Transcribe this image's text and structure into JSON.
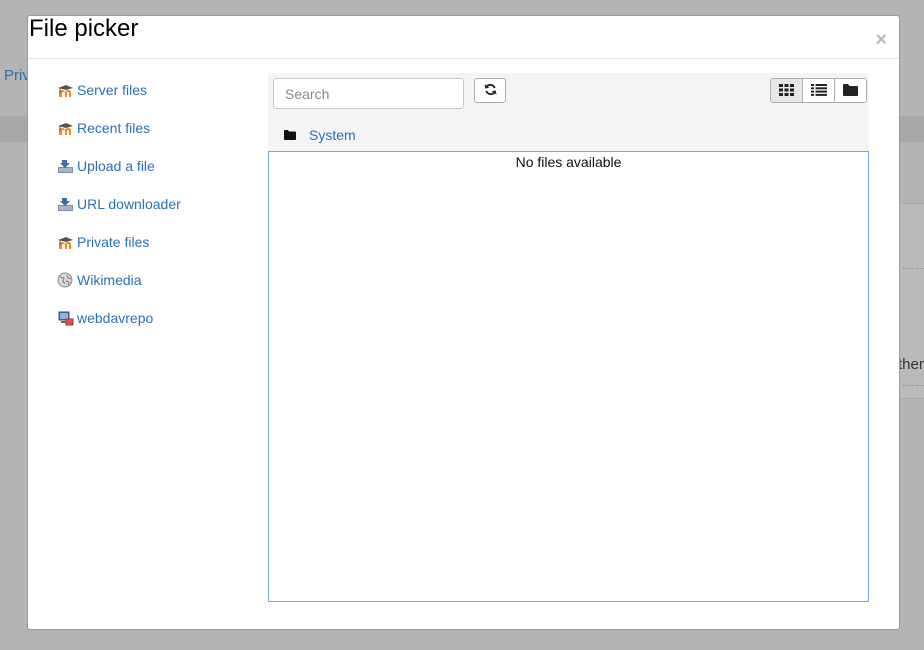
{
  "background": {
    "truncated_link": "Priv",
    "truncated_text": "them"
  },
  "modal": {
    "title": "File picker",
    "close_glyph": "×"
  },
  "repositories": [
    {
      "label": "Server files",
      "icon": "moodle-icon"
    },
    {
      "label": "Recent files",
      "icon": "moodle-icon"
    },
    {
      "label": "Upload a file",
      "icon": "upload-icon"
    },
    {
      "label": "URL downloader",
      "icon": "url-download-icon"
    },
    {
      "label": "Private files",
      "icon": "moodle-icon"
    },
    {
      "label": "Wikimedia",
      "icon": "wikimedia-globe-icon"
    },
    {
      "label": "webdavrepo",
      "icon": "webdav-computer-icon"
    }
  ],
  "toolbar": {
    "search_placeholder": "Search",
    "refresh_icon": "refresh-icon",
    "views": [
      {
        "name": "icons",
        "icon": "grid-view-icon",
        "active": true
      },
      {
        "name": "list",
        "icon": "list-view-icon",
        "active": false
      },
      {
        "name": "tree",
        "icon": "folder-view-icon",
        "active": false
      }
    ]
  },
  "breadcrumb": {
    "icon": "folder-icon",
    "label": "System"
  },
  "content": {
    "empty_message": "No files available"
  },
  "colors": {
    "link": "#2a70b7",
    "overlay": "#b4b4b4",
    "file_area_border": "#7aa6e6"
  }
}
